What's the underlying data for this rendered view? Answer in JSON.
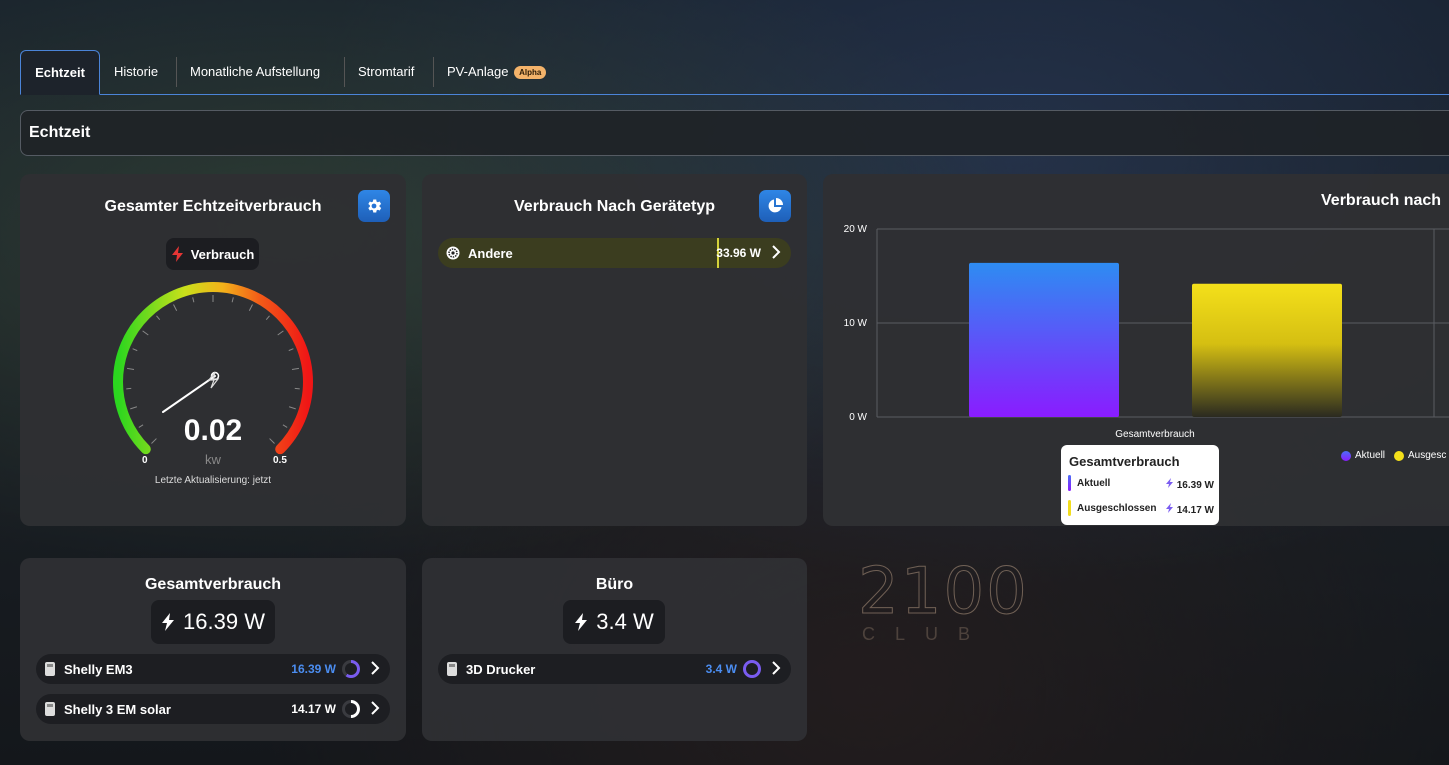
{
  "tabs": {
    "items": [
      {
        "label": "Echtzeit"
      },
      {
        "label": "Historie"
      },
      {
        "label": "Monatliche Aufstellung"
      },
      {
        "label": "Stromtarif"
      },
      {
        "label": "PV-Anlage"
      }
    ],
    "pv_badge": "Alpha"
  },
  "section": {
    "title": "Echtzeit"
  },
  "gauge_card": {
    "title": "Gesamter Echtzeitverbrauch",
    "chip_label": "Verbrauch",
    "value": "0.02",
    "unit": "kw",
    "min": "0",
    "max": "0.5",
    "fraction": 0.04,
    "updated": "Letzte Aktualisierung: jetzt"
  },
  "device_card": {
    "title": "Verbrauch Nach Gerätetyp",
    "rows": [
      {
        "label": "Andere",
        "value": "33.96 W"
      }
    ]
  },
  "chart_card": {
    "title": "Verbrauch nach",
    "tooltip": {
      "title": "Gesamtverbrauch",
      "rows": [
        {
          "name": "Aktuell",
          "value": "16.39 W",
          "color": "#6c55f4"
        },
        {
          "name": "Ausgeschlossen",
          "value": "14.17 W",
          "color": "#f2dd1d"
        }
      ]
    }
  },
  "chart_data": {
    "type": "bar",
    "categories": [
      "Gesamtverbrauch"
    ],
    "series": [
      {
        "name": "Aktuell",
        "values": [
          16.39
        ],
        "color": "#7b2cff"
      },
      {
        "name": "Ausgeschlossen",
        "values": [
          14.17
        ],
        "color": "#f4e01a"
      }
    ],
    "y_ticks": [
      "0 W",
      "10 W",
      "20 W"
    ],
    "ylim": [
      0,
      20
    ],
    "legend": [
      "Aktuell",
      "Ausgesc"
    ],
    "grid": true
  },
  "total_card": {
    "title": "Gesamtverbrauch",
    "value": "16.39 W",
    "rows": [
      {
        "label": "Shelly EM3",
        "value": "16.39 W",
        "ring": 0.6,
        "ring_color": "#7a5cf0",
        "value_color": "#4b8df0"
      },
      {
        "label": "Shelly 3 EM solar",
        "value": "14.17 W",
        "ring": 0.5,
        "ring_color": "#ffffff",
        "value_color": "#ffffff"
      }
    ]
  },
  "office_card": {
    "title": "Büro",
    "value": "3.4 W",
    "rows": [
      {
        "label": "3D Drucker",
        "value": "3.4 W",
        "ring": 1.0,
        "ring_color": "#7a5cf0",
        "value_color": "#4b8df0"
      }
    ]
  },
  "background": {
    "sign_text": "2100",
    "sign_sub": "CLUB"
  }
}
